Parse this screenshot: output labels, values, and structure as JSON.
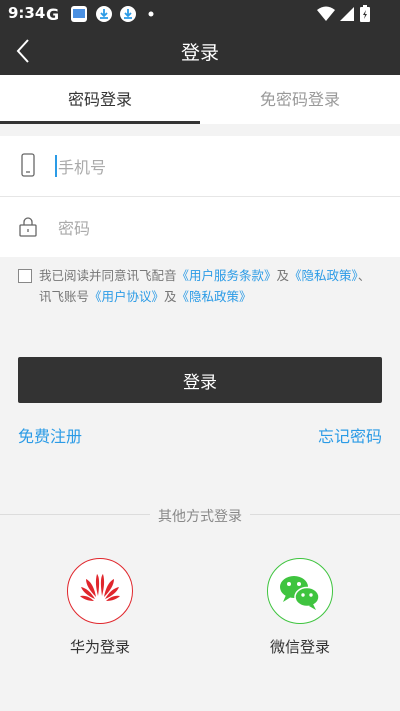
{
  "status_bar": {
    "time": "9:34",
    "app_icons": [
      "google-g-icon",
      "photos-app-icon",
      "download-icon",
      "download-icon",
      "dot-icon"
    ],
    "right_icons": [
      "wifi-icon",
      "cellular-signal-icon",
      "battery-icon"
    ]
  },
  "header": {
    "title": "登录"
  },
  "tabs": [
    {
      "label": "密码登录",
      "active": true
    },
    {
      "label": "免密码登录",
      "active": false
    }
  ],
  "form": {
    "phone_placeholder": "手机号",
    "password_placeholder": "密码"
  },
  "agreement": {
    "text_1": "我已阅读并同意讯飞配音",
    "link_1": "《用户服务条款》",
    "and_1": "及",
    "link_2": "《隐私政策》",
    "sep": "、",
    "text_2": "讯飞账号",
    "link_3": "《用户协议》",
    "and_2": "及",
    "link_4": "《隐私政策》"
  },
  "login_button": "登录",
  "register_link": "免费注册",
  "forgot_link": "忘记密码",
  "other_methods": "其他方式登录",
  "providers": [
    {
      "label": "华为登录",
      "color": "#e0262c",
      "icon": "huawei-logo-icon"
    },
    {
      "label": "微信登录",
      "color": "#3fc43f",
      "icon": "wechat-icon"
    }
  ],
  "colors": {
    "header_bg": "#303030",
    "accent": "#2b9be6",
    "button_bg": "#333333"
  }
}
